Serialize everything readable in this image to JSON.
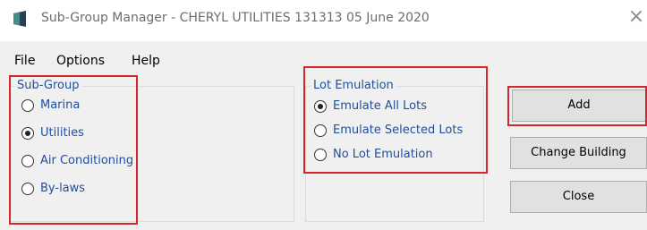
{
  "window": {
    "title": "Sub-Group Manager - CHERYL UTILITIES 131313 05 June 2020",
    "close_glyph": "×",
    "app_icon": "app-logo-icon"
  },
  "menu": {
    "items": [
      "File",
      "Options",
      "Help"
    ]
  },
  "subgroup": {
    "legend": "Sub-Group",
    "options": [
      {
        "label": "Marina",
        "selected": false
      },
      {
        "label": "Utilities",
        "selected": true
      },
      {
        "label": "Air Conditioning",
        "selected": false
      },
      {
        "label": "By-laws",
        "selected": false
      }
    ]
  },
  "lot_emulation": {
    "legend": "Lot Emulation",
    "options": [
      {
        "label": "Emulate All Lots",
        "selected": true
      },
      {
        "label": "Emulate Selected Lots",
        "selected": false
      },
      {
        "label": "No Lot Emulation",
        "selected": false
      }
    ]
  },
  "buttons": {
    "add": "Add",
    "change_building": "Change Building",
    "close": "Close"
  },
  "colors": {
    "highlight": "#d4262b",
    "label_blue": "#1f4e9c"
  }
}
